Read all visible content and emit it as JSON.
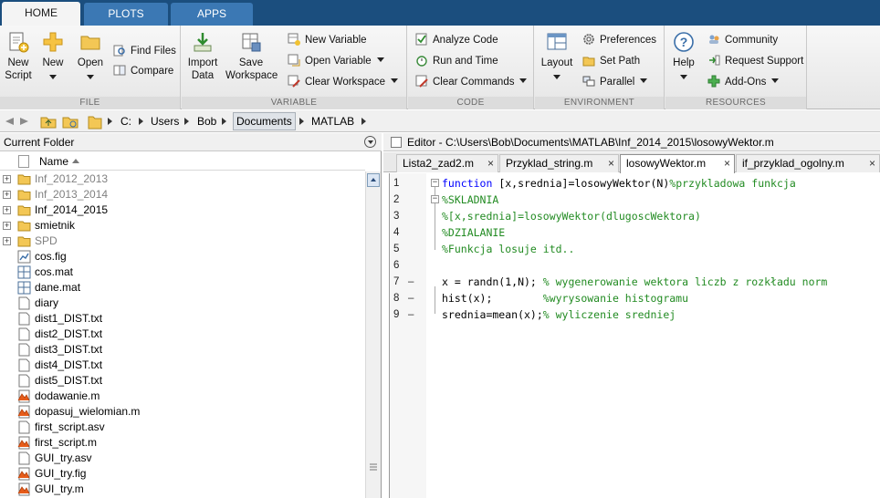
{
  "tabs": [
    "HOME",
    "PLOTS",
    "APPS"
  ],
  "ribbon": {
    "file": {
      "label": "FILE",
      "new_script": "New\nScript",
      "new": "New",
      "open": "Open",
      "find_files": "Find Files",
      "compare": "Compare"
    },
    "variable": {
      "label": "VARIABLE",
      "import_data": "Import\nData",
      "save_workspace": "Save\nWorkspace",
      "new_variable": "New Variable",
      "open_variable": "Open Variable",
      "clear_workspace": "Clear Workspace"
    },
    "code": {
      "label": "CODE",
      "analyze_code": "Analyze Code",
      "run_and_time": "Run and Time",
      "clear_commands": "Clear Commands"
    },
    "environment": {
      "label": "ENVIRONMENT",
      "layout": "Layout",
      "preferences": "Preferences",
      "set_path": "Set Path",
      "parallel": "Parallel"
    },
    "resources": {
      "label": "RESOURCES",
      "help": "Help",
      "community": "Community",
      "request_support": "Request Support",
      "add_ons": "Add-Ons"
    }
  },
  "address": {
    "crumbs": [
      "C:",
      "Users",
      "Bob",
      "Documents",
      "MATLAB"
    ]
  },
  "current_folder": {
    "title": "Current Folder",
    "column_name": "Name",
    "items": [
      {
        "name": "Inf_2012_2013",
        "type": "folder"
      },
      {
        "name": "Inf_2013_2014",
        "type": "folder"
      },
      {
        "name": "Inf_2014_2015",
        "type": "folder-current"
      },
      {
        "name": "smietnik",
        "type": "folder-current"
      },
      {
        "name": "SPD",
        "type": "folder"
      },
      {
        "name": "cos.fig",
        "type": "fig"
      },
      {
        "name": "cos.mat",
        "type": "mat"
      },
      {
        "name": "dane.mat",
        "type": "mat"
      },
      {
        "name": "diary",
        "type": "file"
      },
      {
        "name": "dist1_DIST.txt",
        "type": "file"
      },
      {
        "name": "dist2_DIST.txt",
        "type": "file"
      },
      {
        "name": "dist3_DIST.txt",
        "type": "file"
      },
      {
        "name": "dist4_DIST.txt",
        "type": "file"
      },
      {
        "name": "dist5_DIST.txt",
        "type": "file"
      },
      {
        "name": "dodawanie.m",
        "type": "mfile"
      },
      {
        "name": "dopasuj_wielomian.m",
        "type": "mfile"
      },
      {
        "name": "first_script.asv",
        "type": "file"
      },
      {
        "name": "first_script.m",
        "type": "mfile"
      },
      {
        "name": "GUI_try.asv",
        "type": "file"
      },
      {
        "name": "GUI_try.fig",
        "type": "mfile"
      },
      {
        "name": "GUI_try.m",
        "type": "mfile"
      }
    ]
  },
  "editor": {
    "title": "Editor - C:\\Users\\Bob\\Documents\\MATLAB\\Inf_2014_2015\\losowyWektor.m",
    "tabs": [
      {
        "label": "Lista2_zad2.m",
        "close": "×"
      },
      {
        "label": "Przyklad_string.m",
        "close": "×"
      },
      {
        "label": "losowyWektor.m",
        "close": "×"
      },
      {
        "label": "if_przyklad_ogolny.m",
        "close": "×"
      }
    ],
    "lines": [
      {
        "n": "1",
        "bp": "",
        "parts": [
          {
            "t": "function",
            "c": "kw"
          },
          {
            "t": " [x,srednia]=losowyWektor(N)",
            "c": "tx"
          },
          {
            "t": "%przykladowa funkcja",
            "c": "cm"
          }
        ]
      },
      {
        "n": "2",
        "bp": "",
        "parts": [
          {
            "t": "%SKLADNIA",
            "c": "cm"
          }
        ]
      },
      {
        "n": "3",
        "bp": "",
        "parts": [
          {
            "t": "%[x,srednia]=losowyWektor(dlugoscWektora)",
            "c": "cm"
          }
        ]
      },
      {
        "n": "4",
        "bp": "",
        "parts": [
          {
            "t": "%DZIALANIE",
            "c": "cm"
          }
        ]
      },
      {
        "n": "5",
        "bp": "",
        "parts": [
          {
            "t": "%Funkcja losuje itd..",
            "c": "cm"
          }
        ]
      },
      {
        "n": "6",
        "bp": "",
        "parts": []
      },
      {
        "n": "7",
        "bp": "–",
        "parts": [
          {
            "t": "x = randn(1,N); ",
            "c": "tx"
          },
          {
            "t": "% wygenerowanie wektora liczb z rozkładu norm",
            "c": "cm"
          }
        ]
      },
      {
        "n": "8",
        "bp": "–",
        "parts": [
          {
            "t": "hist(x);        ",
            "c": "tx"
          },
          {
            "t": "%wyrysowanie histogramu",
            "c": "cm"
          }
        ]
      },
      {
        "n": "9",
        "bp": "–",
        "parts": [
          {
            "t": "srednia=mean(x);",
            "c": "tx"
          },
          {
            "t": "% wyliczenie sredniej",
            "c": "cm"
          }
        ]
      }
    ]
  }
}
